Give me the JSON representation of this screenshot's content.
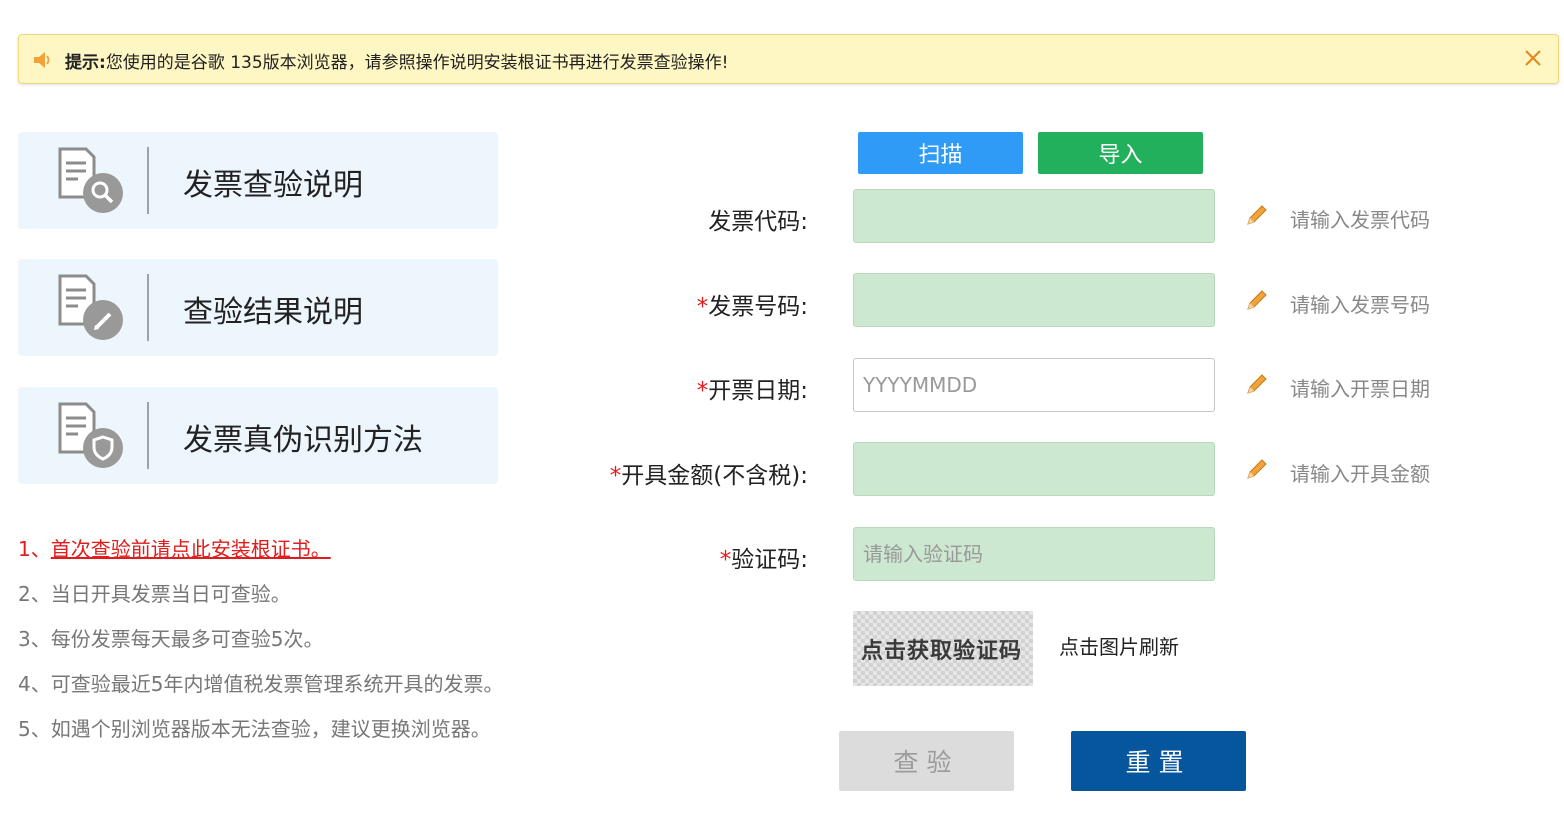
{
  "notice": {
    "icon": "speaker-icon",
    "label": "提示:",
    "message": "您使用的是谷歌 135版本浏览器，请参照操作说明安装根证书再进行发票查验操作!",
    "close_icon": "close-icon"
  },
  "cards": [
    {
      "label": "发票查验说明",
      "icon": "document-search-icon"
    },
    {
      "label": "查验结果说明",
      "icon": "document-edit-icon"
    },
    {
      "label": "发票真伪识别方法",
      "icon": "document-shield-icon"
    }
  ],
  "notes": [
    {
      "prefix": "1、",
      "text": "首次查验前请点此安装根证书。"
    },
    {
      "text": "2、当日开具发票当日可查验。"
    },
    {
      "text": "3、每份发票每天最多可查验5次。"
    },
    {
      "text": "4、可查验最近5年内增值税发票管理系统开具的发票。"
    },
    {
      "text": "5、如遇个别浏览器版本无法查验，建议更换浏览器。"
    }
  ],
  "toolbar": {
    "scan_label": "扫描",
    "import_label": "导入"
  },
  "form": {
    "invoice_code": {
      "label": "发票代码:",
      "value": "",
      "hint": "请输入发票代码"
    },
    "invoice_number": {
      "required": "*",
      "label": "发票号码:",
      "value": "",
      "hint": "请输入发票号码"
    },
    "invoice_date": {
      "required": "*",
      "label": "开票日期:",
      "placeholder": "YYYYMMDD",
      "hint": "请输入开票日期"
    },
    "amount": {
      "required": "*",
      "label": "开具金额(不含税):",
      "value": "",
      "hint": "请输入开具金额"
    },
    "captcha": {
      "required": "*",
      "label": "验证码:",
      "placeholder": "请输入验证码",
      "image_text": "点击获取验证码",
      "refresh_label": "点击图片刷新"
    }
  },
  "actions": {
    "check_label": "查验",
    "reset_label": "重置"
  },
  "colors": {
    "notice_bg": "#fef7c3",
    "card_bg": "#edf6fd",
    "scan_blue": "#2f9bf6",
    "import_green": "#23b05c",
    "input_green": "#cde8d0",
    "required_red": "#e01c1c",
    "reset_blue": "#05569c",
    "check_disabled": "#dcdcdc"
  }
}
